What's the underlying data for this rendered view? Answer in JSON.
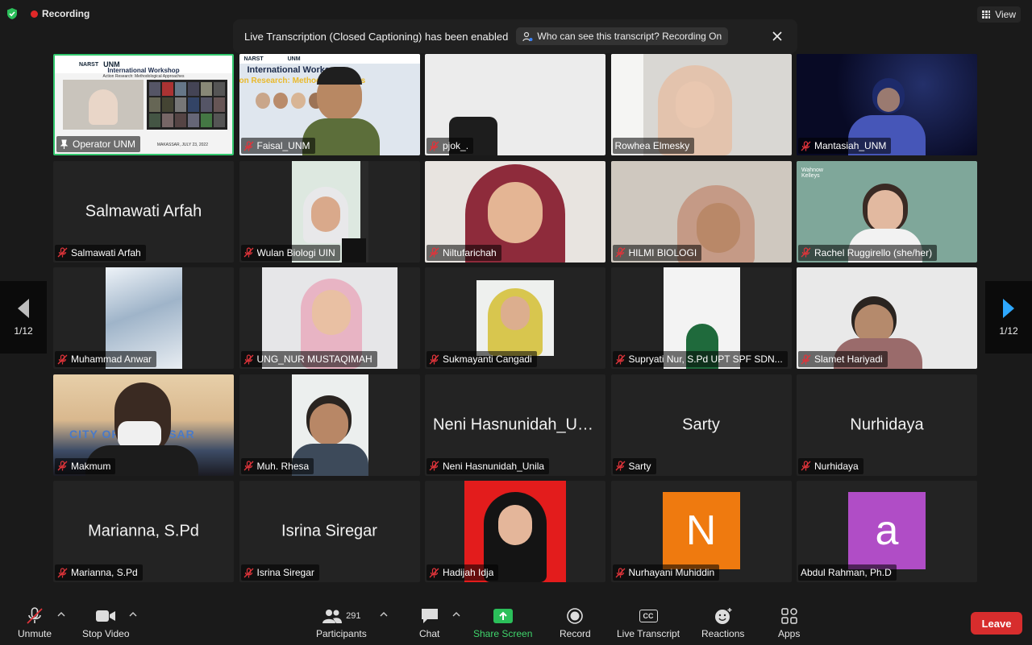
{
  "topbar": {
    "recording_label": "Recording",
    "view_label": "View"
  },
  "banner": {
    "message": "Live Transcription (Closed Captioning) has been enabled",
    "who_can_see": "Who can see this transcript? Recording On"
  },
  "tiles": [
    {
      "name": "Operator UNM"
    },
    {
      "name": "Faisal_UNM"
    },
    {
      "name": "pjok_."
    },
    {
      "name": "Rowhea Elmesky"
    },
    {
      "name": "Mantasiah_UNM"
    },
    {
      "name": "Salmawati Arfah",
      "center": "Salmawati Arfah"
    },
    {
      "name": "Wulan Biologi UIN"
    },
    {
      "name": "Niltufarichah"
    },
    {
      "name": "HILMI BIOLOGI"
    },
    {
      "name": "Rachel Ruggirello (she/her)"
    },
    {
      "name": "Muhammad Anwar"
    },
    {
      "name": "UNG_NUR MUSTAQIMAH"
    },
    {
      "name": "Sukmayanti Cangadi"
    },
    {
      "name": "Supryati Nur, S.Pd UPT SPF SDN..."
    },
    {
      "name": "Slamet Hariyadi"
    },
    {
      "name": "Makmum"
    },
    {
      "name": "Muh. Rhesa"
    },
    {
      "name": "Neni Hasnunidah_Unila",
      "center": "Neni Hasnunidah_Un..."
    },
    {
      "name": "Sarty",
      "center": "Sarty"
    },
    {
      "name": "Nurhidaya",
      "center": "Nurhidaya"
    },
    {
      "name": "Marianna, S.Pd",
      "center": "Marianna, S.Pd"
    },
    {
      "name": "Isrina Siregar",
      "center": "Isrina Siregar"
    },
    {
      "name": "Hadijah Idja"
    },
    {
      "name": "Nurhayani Muhiddin",
      "avatar": "N",
      "avatar_color": "#ef7a0f"
    },
    {
      "name": "Abdul Rahman, Ph.D",
      "avatar": "a",
      "avatar_color": "#b04dc6"
    }
  ],
  "tile_overlays": {
    "workshop_logo": "NARST",
    "workshop_unm": "UNM",
    "workshop_title": "International Workshop",
    "workshop_sub": "Action Research: Methodological Approaches",
    "workshop_date": "MAKASSAR, JULY 23, 2022",
    "workshop_title_b": "International Works",
    "workshop_sub_b": "on Research: Methodologi  aches",
    "city_sign": "CITY OF MAKASSAR",
    "rachel_logo": "Wahnow Kelleys"
  },
  "pager": {
    "left": "1/12",
    "right": "1/12"
  },
  "toolbar": {
    "unmute": "Unmute",
    "stop_video": "Stop Video",
    "participants": "Participants",
    "participants_count": "291",
    "chat": "Chat",
    "share_screen": "Share Screen",
    "record": "Record",
    "live_transcript": "Live Transcript",
    "cc_badge": "CC",
    "reactions": "Reactions",
    "apps": "Apps",
    "leave": "Leave"
  },
  "colors": {
    "active_speaker": "#32c86e",
    "share_green": "#3fd46b",
    "leave_red": "#d72d2d",
    "muted_red": "#e0343a"
  }
}
